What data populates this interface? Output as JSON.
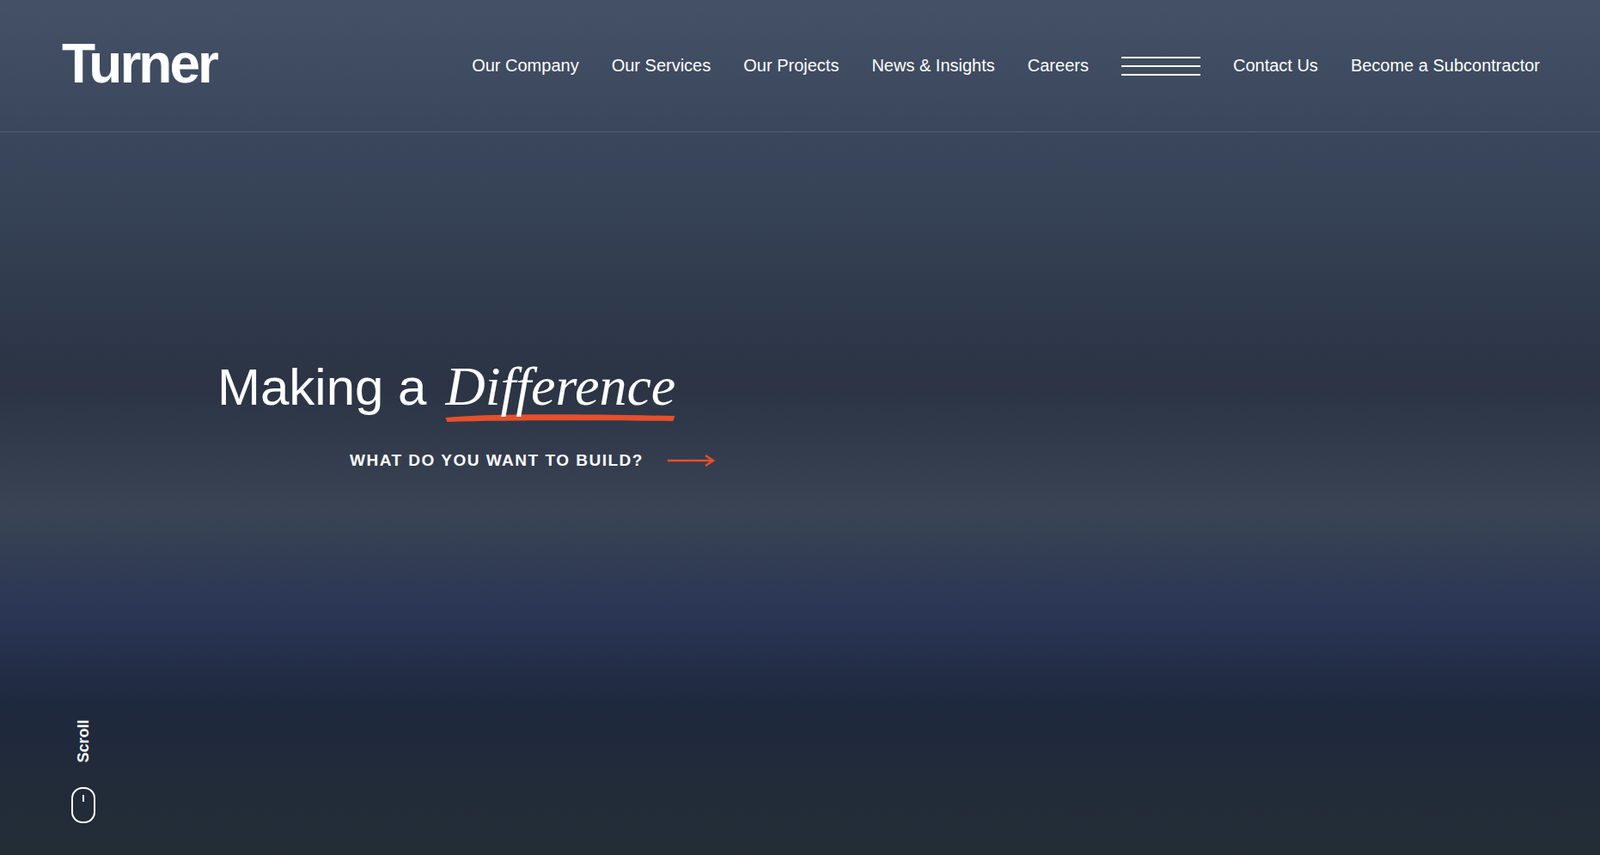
{
  "header": {
    "logo": "Turner",
    "nav": [
      {
        "label": "Our Company"
      },
      {
        "label": "Our Services"
      },
      {
        "label": "Our Projects"
      },
      {
        "label": "News & Insights"
      },
      {
        "label": "Careers"
      }
    ],
    "secondary": [
      {
        "label": "Contact Us"
      },
      {
        "label": "Become a Subcontractor"
      }
    ]
  },
  "hero": {
    "title": "Making a",
    "highlight": "Difference",
    "cta": "WHAT DO YOU WANT TO BUILD?"
  },
  "scroll": {
    "label": "Scroll"
  }
}
